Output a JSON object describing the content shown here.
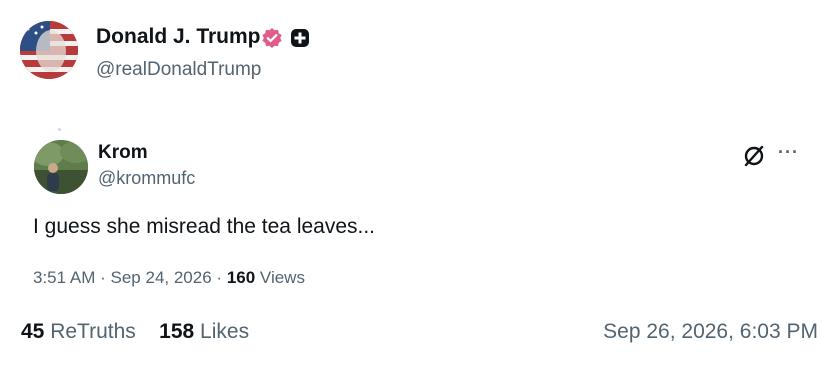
{
  "author": {
    "name": "Donald J. Trump",
    "handle": "@realDonaldTrump",
    "icons": [
      "avatar",
      "verified-badge-icon",
      "plus-badge-icon"
    ]
  },
  "reply": {
    "name": "Krom",
    "handle": "@krommufc",
    "text": "I guess she misread the tea leaves...",
    "time": "3:51 AM",
    "separator": "·",
    "date": "Sep 24, 2026",
    "views_count": "160",
    "views_label": "Views",
    "icons": [
      "no-sign-icon",
      "more-icon"
    ],
    "more_label": "···"
  },
  "stats": {
    "retruths_count": "45",
    "retruths_label": "ReTruths",
    "likes_count": "158",
    "likes_label": "Likes"
  },
  "post_date": "Sep 26, 2026, 6:03 PM",
  "colors": {
    "text_primary": "#0f1419",
    "text_secondary": "#536471",
    "verified_badge": "#e05d8a"
  }
}
